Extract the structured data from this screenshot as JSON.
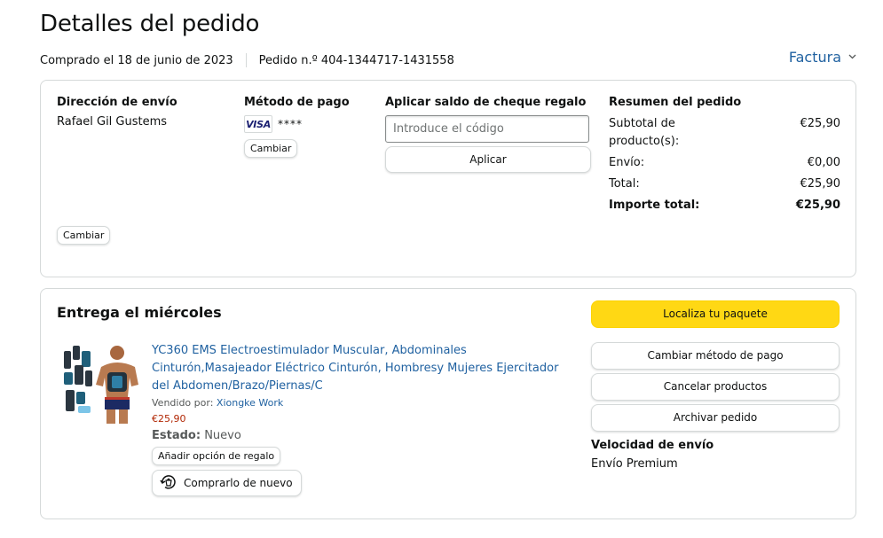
{
  "header": {
    "title": "Detalles del pedido",
    "purchased": "Comprado el 18 de junio de 2023",
    "order_number": "Pedido n.º 404-1344717-1431558",
    "invoice_label": "Factura"
  },
  "shipping": {
    "heading": "Dirección de envío",
    "name": "Rafael Gil Gustems",
    "change_label": "Cambiar"
  },
  "payment": {
    "heading": "Método de pago",
    "card_brand": "VISA",
    "card_mask": "****",
    "change_label": "Cambiar"
  },
  "gift_card": {
    "heading": "Aplicar saldo de cheque regalo",
    "placeholder": "Introduce el código",
    "apply_label": "Aplicar"
  },
  "summary": {
    "heading": "Resumen del pedido",
    "rows": [
      {
        "label": "Subtotal de producto(s):",
        "value": "€25,90"
      },
      {
        "label": "Envío:",
        "value": "€0,00"
      },
      {
        "label": "Total:",
        "value": "€25,90"
      }
    ],
    "grand_total_label": "Importe total:",
    "grand_total_value": "€25,90"
  },
  "delivery": {
    "heading": "Entrega el miércoles",
    "product": {
      "title": "YC360 EMS Electroestimulador Muscular, Abdominales Cinturón,Masajeador Eléctrico Cinturón, Hombresy Mujeres Ejercitador del Abdomen/Brazo/Piernas/C",
      "sold_by_label": "Vendido por:",
      "seller": "Xiongke Work",
      "price": "€25,90",
      "status_label": "Estado:",
      "status_value": "Nuevo",
      "gift_option_label": "Añadir opción de regalo",
      "rebuy_label": "Comprarlo de nuevo"
    },
    "actions": {
      "track": "Localiza tu paquete",
      "change_payment": "Cambiar método de pago",
      "cancel": "Cancelar productos",
      "archive": "Archivar pedido"
    },
    "speed_heading": "Velocidad de envío",
    "speed_value": "Envío Premium"
  },
  "colors": {
    "link": "#2162a1",
    "price": "#b12704",
    "primary_button": "#ffd814",
    "border": "#d5d9d9"
  },
  "icons": [
    "chevron-down-icon",
    "visa-card-icon",
    "rebuy-icon",
    "product-thumbnail"
  ]
}
